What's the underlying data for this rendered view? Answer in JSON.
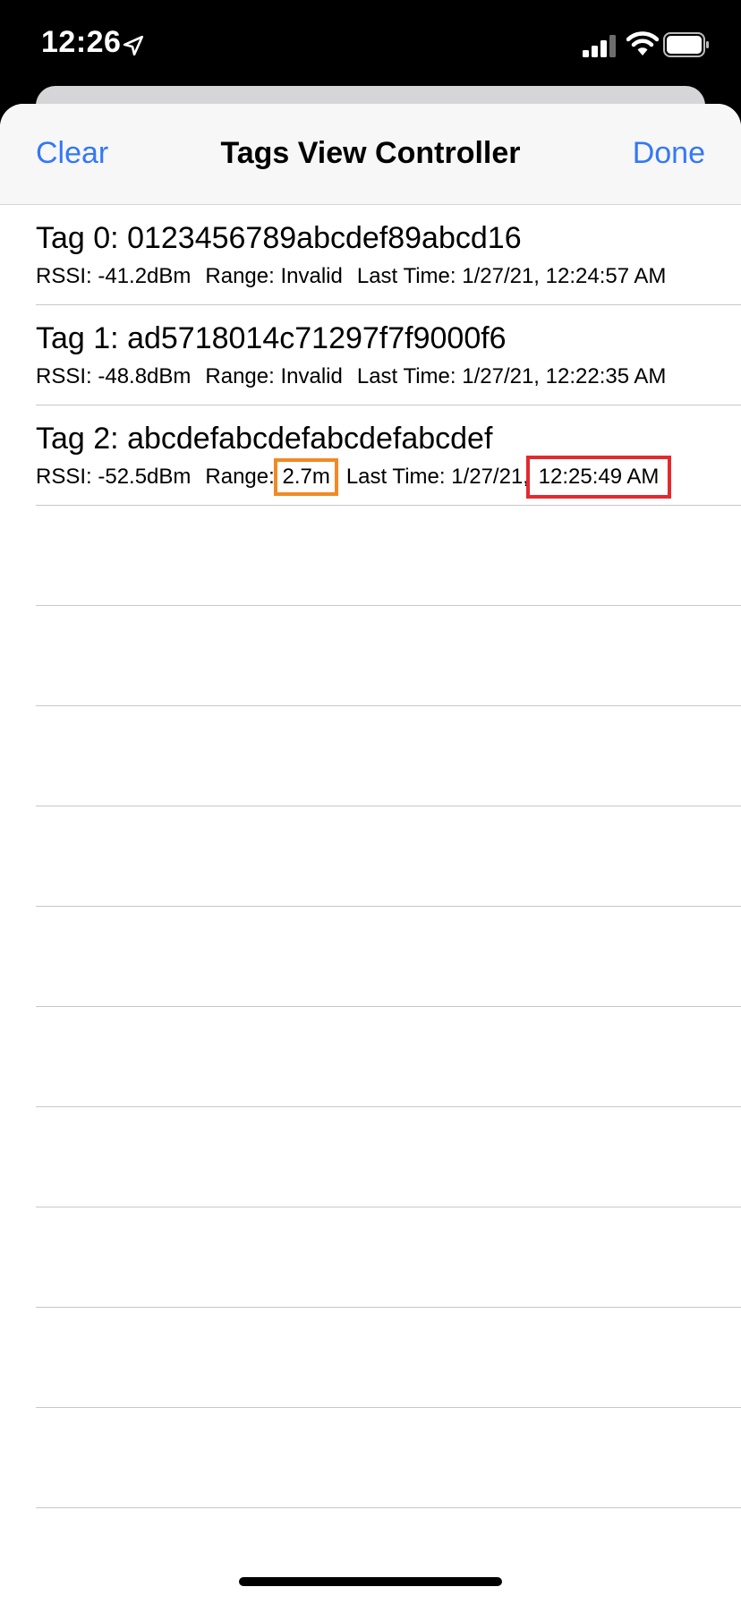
{
  "status_bar": {
    "time": "12:26",
    "icons": [
      "location-arrow-icon",
      "cellular-signal-icon",
      "wifi-icon",
      "battery-icon"
    ]
  },
  "nav": {
    "left_button": "Clear",
    "title": "Tags View Controller",
    "right_button": "Done"
  },
  "colors": {
    "accent": "#3478f6",
    "highlight_orange": "#f08a24",
    "highlight_red": "#e22a2f"
  },
  "tags": [
    {
      "title": "Tag 0: 0123456789abcdef89abcd16",
      "rssi": "RSSI: -41.2dBm",
      "range_label": "Range:",
      "range_value": "Invalid",
      "last_time_label": "Last Time:",
      "date": "1/27/21,",
      "time": "12:24:57 AM"
    },
    {
      "title": "Tag 1: ad5718014c71297f7f9000f6",
      "rssi": "RSSI: -48.8dBm",
      "range_label": "Range:",
      "range_value": "Invalid",
      "last_time_label": "Last Time:",
      "date": "1/27/21,",
      "time": "12:22:35 AM"
    },
    {
      "title": "Tag 2: abcdefabcdefabcdefabcdef",
      "rssi": "RSSI: -52.5dBm",
      "range_label": "Range:",
      "range_value": "2.7m",
      "last_time_label": "Last Time:",
      "date": "1/27/21,",
      "time": "12:25:49 AM"
    }
  ]
}
